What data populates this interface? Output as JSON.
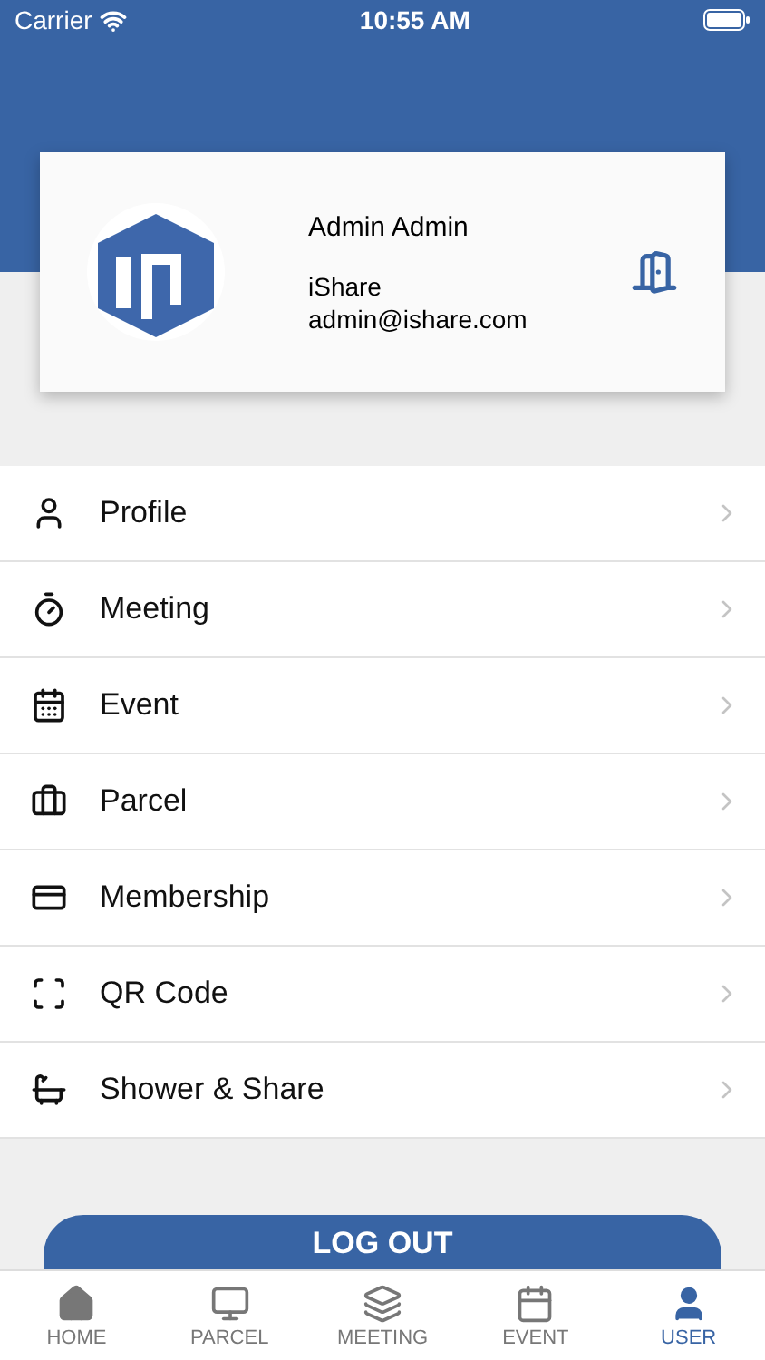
{
  "status_bar": {
    "carrier": "Carrier",
    "time": "10:55 AM"
  },
  "profile_card": {
    "name": "Admin Admin",
    "company": "iShare",
    "email": "admin@ishare.com"
  },
  "menu": [
    {
      "kind": "profile",
      "label": "Profile"
    },
    {
      "kind": "meeting",
      "label": "Meeting"
    },
    {
      "kind": "event",
      "label": "Event"
    },
    {
      "kind": "parcel",
      "label": "Parcel"
    },
    {
      "kind": "membership",
      "label": "Membership"
    },
    {
      "kind": "qr",
      "label": "QR Code"
    },
    {
      "kind": "shower",
      "label": "Shower & Share"
    }
  ],
  "logout_button": "LOG OUT",
  "tab_bar": [
    {
      "kind": "home",
      "label": "HOME",
      "selected": false
    },
    {
      "kind": "parcel",
      "label": "PARCEL",
      "selected": false
    },
    {
      "kind": "meeting",
      "label": "MEETING",
      "selected": false
    },
    {
      "kind": "event",
      "label": "EVENT",
      "selected": false
    },
    {
      "kind": "user",
      "label": "USER",
      "selected": true
    }
  ]
}
